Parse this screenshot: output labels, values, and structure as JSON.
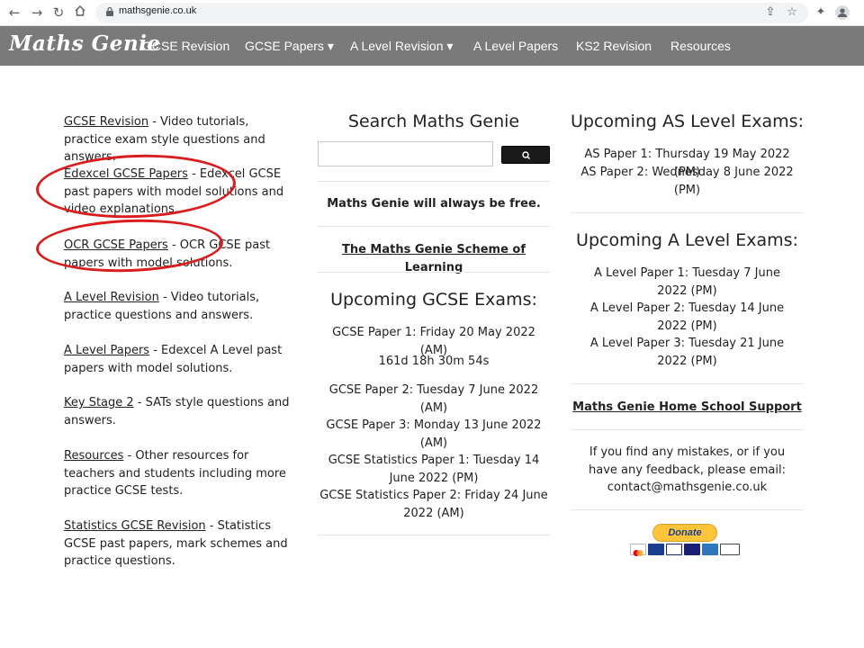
{
  "browser": {
    "url": "mathsgenie.co.uk"
  },
  "site": {
    "logo": "Maths Genie",
    "nav": [
      {
        "label": "GCSE Revision"
      },
      {
        "label": "GCSE Papers ▾"
      },
      {
        "label": "A Level Revision ▾"
      },
      {
        "label": "A Level Papers"
      },
      {
        "label": "KS2 Revision"
      },
      {
        "label": "Resources"
      }
    ]
  },
  "left": {
    "items": [
      {
        "link": "GCSE Revision",
        "desc": " - Video tutorials, practice exam style questions and answers."
      },
      {
        "link": "Edexcel GCSE Papers",
        "desc": " - Edexcel GCSE past papers with model solutions and video explanations."
      },
      {
        "link": "OCR GCSE Papers",
        "desc": " - OCR GCSE past papers with model solutions."
      },
      {
        "link": "A Level Revision",
        "desc": " - Video tutorials, practice questions and answers."
      },
      {
        "link": "A Level Papers",
        "desc": " - Edexcel A Level past papers with model solutions."
      },
      {
        "link": "Key Stage 2",
        "desc": " - SATs style questions and answers."
      },
      {
        "link": "Resources",
        "desc": " - Other resources for teachers and students including more practice GCSE tests."
      },
      {
        "link": "Statistics GCSE Revision",
        "desc": " - Statistics GCSE past papers, mark schemes and practice questions."
      }
    ]
  },
  "middle": {
    "search_title": "Search Maths Genie",
    "search_placeholder": "",
    "free_text": "Maths Genie will always be free.",
    "scheme_link": "The Maths Genie Scheme of Learning",
    "gcse_title": "Upcoming GCSE Exams:",
    "paper1": "GCSE Paper 1: Friday 20 May 2022 (AM)",
    "countdown": "161d 18h 30m 54s",
    "others": [
      "GCSE Paper 2: Tuesday 7 June 2022 (AM)",
      "GCSE Paper 3: Monday 13 June 2022 (AM)",
      "GCSE Statistics Paper 1: Tuesday 14 June 2022 (PM)",
      "GCSE Statistics Paper 2: Friday 24 June 2022 (AM)"
    ]
  },
  "right": {
    "as_title": "Upcoming AS Level Exams:",
    "as_exams": [
      "AS Paper 1: Thursday 19 May 2022 (PM)",
      "AS Paper 2: Wednesday 8 June 2022 (PM)"
    ],
    "a_title": "Upcoming A Level Exams:",
    "a_exams": [
      "A Level Paper 1: Tuesday 7 June 2022 (PM)",
      "A Level Paper 2: Tuesday 14 June 2022 (PM)",
      "A Level Paper 3: Tuesday 21 June 2022 (PM)"
    ],
    "home_school_link": "Maths Genie Home School Support",
    "feedback": "If you find any mistakes, or if you have any feedback, please email: contact@mathsgenie.co.uk",
    "donate_label": "Donate"
  },
  "colors": {
    "nav_bg": "#7a7a7a",
    "annotation": "#d81e1e",
    "donate": "#ffc439"
  }
}
